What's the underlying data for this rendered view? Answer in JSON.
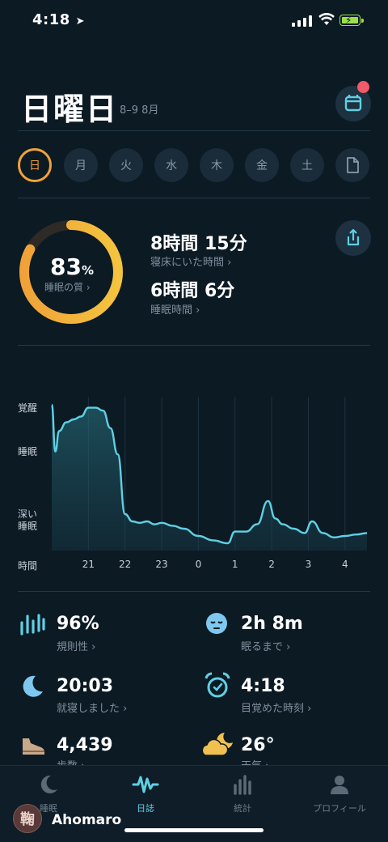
{
  "status": {
    "time": "4:18"
  },
  "header": {
    "day": "日曜日",
    "range": "8–9 8月"
  },
  "days": [
    {
      "label": "日",
      "selected": true
    },
    {
      "label": "月"
    },
    {
      "label": "火"
    },
    {
      "label": "水"
    },
    {
      "label": "木"
    },
    {
      "label": "金"
    },
    {
      "label": "土"
    }
  ],
  "summary": {
    "quality_value": "83",
    "quality_unit": "%",
    "quality_label": "睡眠の質 ›",
    "quality_fraction": 0.83,
    "in_bed_value": "8時間 15分",
    "in_bed_label": "寝床にいた時間 ›",
    "sleep_value": "6時間 6分",
    "sleep_label": "睡眠時間 ›"
  },
  "chart_data": {
    "type": "area",
    "y_labels": [
      "覚醒",
      "睡眠",
      "深い",
      "睡眠"
    ],
    "x_title": "時間",
    "x_ticks": [
      "21",
      "22",
      "23",
      "0",
      "1",
      "2",
      "3",
      "4"
    ],
    "y_levels": {
      "awake": 1,
      "sleep": 0.7,
      "deep": 0
    },
    "x": [
      20.0,
      20.1,
      20.2,
      20.4,
      20.6,
      20.8,
      21.0,
      21.2,
      21.4,
      21.6,
      21.8,
      22.0,
      22.2,
      22.4,
      22.6,
      22.8,
      23.0,
      23.3,
      23.6,
      24.0,
      24.4,
      24.8,
      25.0,
      25.3,
      25.6,
      25.9,
      26.1,
      26.3,
      26.6,
      26.9,
      27.1,
      27.4,
      27.7,
      28.0,
      28.3,
      28.6
    ],
    "values": [
      1.0,
      0.68,
      0.82,
      0.88,
      0.9,
      0.92,
      0.98,
      0.98,
      0.96,
      0.84,
      0.66,
      0.25,
      0.2,
      0.19,
      0.2,
      0.18,
      0.19,
      0.17,
      0.15,
      0.1,
      0.07,
      0.05,
      0.13,
      0.13,
      0.18,
      0.34,
      0.22,
      0.18,
      0.15,
      0.12,
      0.2,
      0.12,
      0.09,
      0.1,
      0.11,
      0.12
    ]
  },
  "stats": [
    {
      "value": "96%",
      "label": "規則性 ›",
      "icon": "bars-icon",
      "color": "#5fd0e4"
    },
    {
      "value": "2h  8m",
      "label": "眠るまで ›",
      "icon": "sleepy-face-icon",
      "color": "#7ec8f0"
    },
    {
      "value": "20:03",
      "label": "就寝しました ›",
      "icon": "moon-icon",
      "color": "#7ec8f0"
    },
    {
      "value": "4:18",
      "label": "目覚めた時刻 ›",
      "icon": "alarm-clock-icon",
      "color": "#5fd0e4"
    },
    {
      "value": "4,439",
      "label": "歩数 ›",
      "icon": "shoe-icon",
      "color": "#c9a98a"
    },
    {
      "value": "26°",
      "label": "天気 ›",
      "icon": "cloud-moon-icon",
      "color": "#f0c050"
    }
  ],
  "tabs": [
    {
      "label": "睡眠",
      "icon": "moon-icon"
    },
    {
      "label": "日誌",
      "icon": "wave-icon",
      "active": true
    },
    {
      "label": "統計",
      "icon": "bars-icon"
    },
    {
      "label": "プロフィール",
      "icon": "person-icon"
    }
  ],
  "watermark": {
    "name": "Ahomaro",
    "avatar": "鞠"
  }
}
